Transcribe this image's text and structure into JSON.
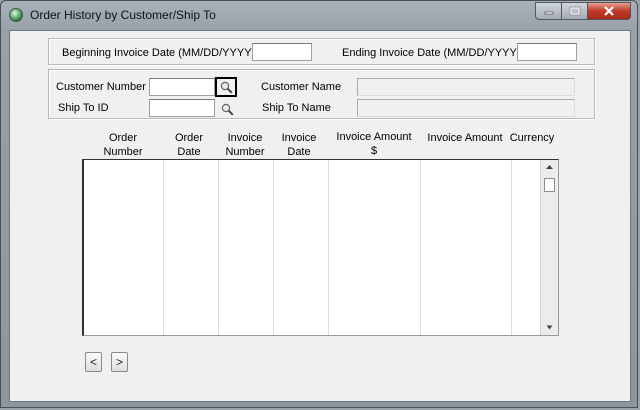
{
  "window": {
    "title": "Order History by Customer/Ship To"
  },
  "icons": {
    "app": "app-globe-icon",
    "minimize": "minimize-icon",
    "maximize": "maximize-icon",
    "close": "close-icon",
    "lookup": "magnifier-icon"
  },
  "dates": {
    "begin_label": "Beginning Invoice Date (MM/DD/YYYY)",
    "begin_value": "",
    "end_label": "Ending Invoice Date (MM/DD/YYYY)",
    "end_value": ""
  },
  "customer": {
    "number_label": "Customer Number",
    "number_value": "",
    "name_label": "Customer Name",
    "name_value": "",
    "shipto_label": "Ship To ID",
    "shipto_value": "",
    "shipto_name_label": "Ship To Name",
    "shipto_name_value": ""
  },
  "grid": {
    "columns": [
      {
        "line1": "Order",
        "line2": "Number"
      },
      {
        "line1": "Order",
        "line2": "Date"
      },
      {
        "line1": "Invoice",
        "line2": "Number"
      },
      {
        "line1": "Invoice",
        "line2": "Date"
      },
      {
        "line1": "Invoice Amount",
        "line2": "$"
      },
      {
        "line1": "",
        "line2": "Invoice Amount"
      },
      {
        "line1": "",
        "line2": "Currency"
      }
    ],
    "rows": []
  },
  "pager": {
    "prev": "<",
    "next": ">"
  }
}
